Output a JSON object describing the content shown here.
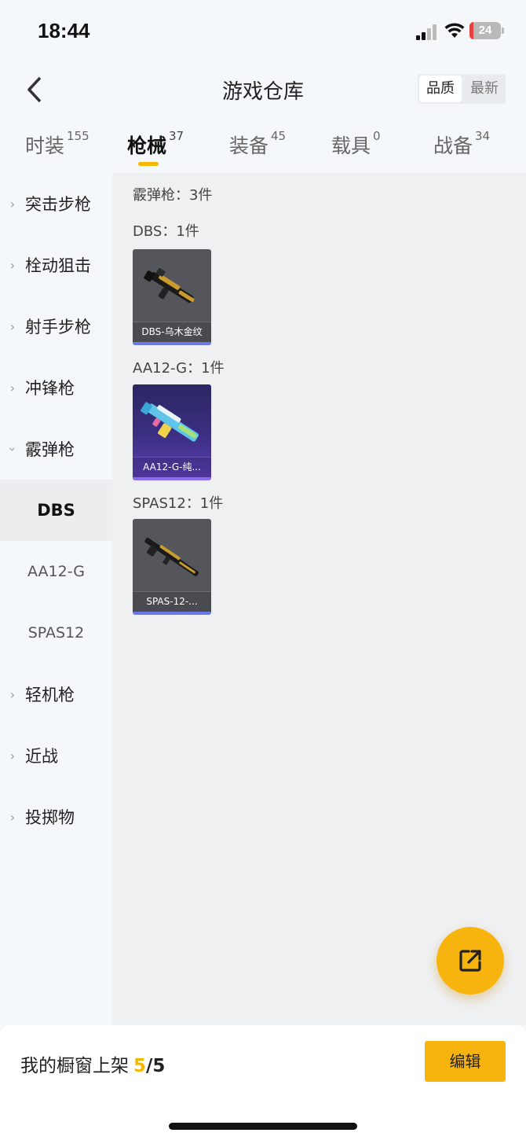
{
  "status_bar": {
    "time": "18:44",
    "battery": "24"
  },
  "header": {
    "title": "游戏仓库",
    "sort_options": [
      "品质",
      "最新"
    ],
    "sort_selected": "品质"
  },
  "tabs": [
    {
      "label": "时装",
      "count": "155"
    },
    {
      "label": "枪械",
      "count": "37",
      "active": true
    },
    {
      "label": "装备",
      "count": "45"
    },
    {
      "label": "载具",
      "count": "0"
    },
    {
      "label": "战备",
      "count": "34"
    }
  ],
  "sidebar": {
    "items": [
      {
        "label": "突击步枪"
      },
      {
        "label": "栓动狙击"
      },
      {
        "label": "射手步枪"
      },
      {
        "label": "冲锋枪"
      },
      {
        "label": "霰弹枪",
        "expanded": true
      },
      {
        "label": "轻机枪"
      },
      {
        "label": "近战"
      },
      {
        "label": "投掷物"
      }
    ],
    "subitems": [
      {
        "label": "DBS",
        "active": true
      },
      {
        "label": "AA12-G"
      },
      {
        "label": "SPAS12"
      }
    ]
  },
  "main": {
    "section_title": "霰弹枪：3件",
    "groups": [
      {
        "title": "DBS：1件",
        "item_name": "DBS-乌木金纹",
        "rarity": "blue"
      },
      {
        "title": "AA12-G：1件",
        "item_name": "AA12-G-纯...",
        "rarity": "purple"
      },
      {
        "title": "SPAS12：1件",
        "item_name": "SPAS-12-...",
        "rarity": "blue"
      }
    ]
  },
  "bottom_bar": {
    "label": "我的橱窗上架",
    "count": "5",
    "total": "/5",
    "edit_label": "编辑"
  },
  "colors": {
    "accent": "#f8b40e",
    "underline": "#f5b800",
    "rarity_blue": "#6a78e8",
    "rarity_purple": "#8a6cf0"
  }
}
